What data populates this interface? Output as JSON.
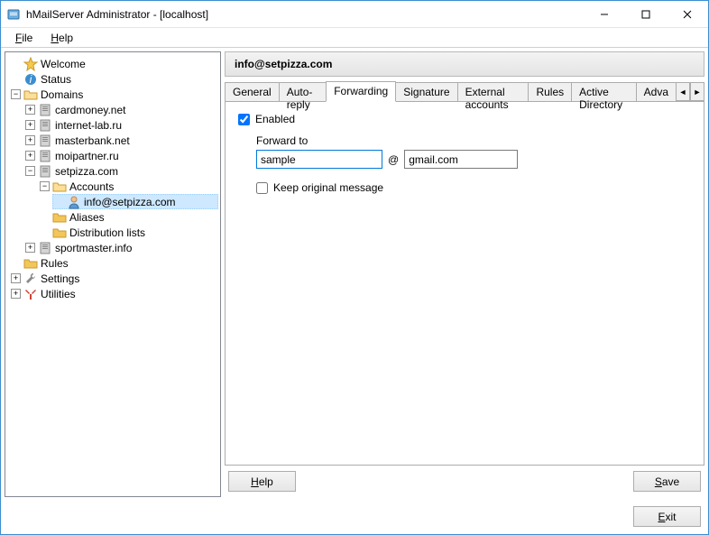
{
  "window": {
    "title": "hMailServer Administrator - [localhost]"
  },
  "menu": {
    "file": "File",
    "file_key": "F",
    "help": "Help",
    "help_key": "H"
  },
  "tree": {
    "welcome": "Welcome",
    "status": "Status",
    "domains": "Domains",
    "domain_list": [
      "cardmoney.net",
      "internet-lab.ru",
      "masterbank.net",
      "moipartner.ru",
      "setpizza.com",
      "sportmaster.info"
    ],
    "accounts": "Accounts",
    "account_entry": "info@setpizza.com",
    "aliases": "Aliases",
    "dist_lists": "Distribution lists",
    "rules": "Rules",
    "settings": "Settings",
    "utilities": "Utilities"
  },
  "panel": {
    "title": "info@setpizza.com",
    "tabs": [
      "General",
      "Auto-reply",
      "Forwarding",
      "Signature",
      "External accounts",
      "Rules",
      "Active Directory",
      "Adva"
    ],
    "active_tab_index": 2,
    "enabled_label": "Enabled",
    "enabled_checked": true,
    "forward_to_label": "Forward to",
    "local_value": "sample",
    "at": "@",
    "domain_value": "gmail.com",
    "keep_original_label": "Keep original message",
    "keep_original_checked": false
  },
  "buttons": {
    "help": "Help",
    "save": "Save",
    "exit": "Exit"
  }
}
